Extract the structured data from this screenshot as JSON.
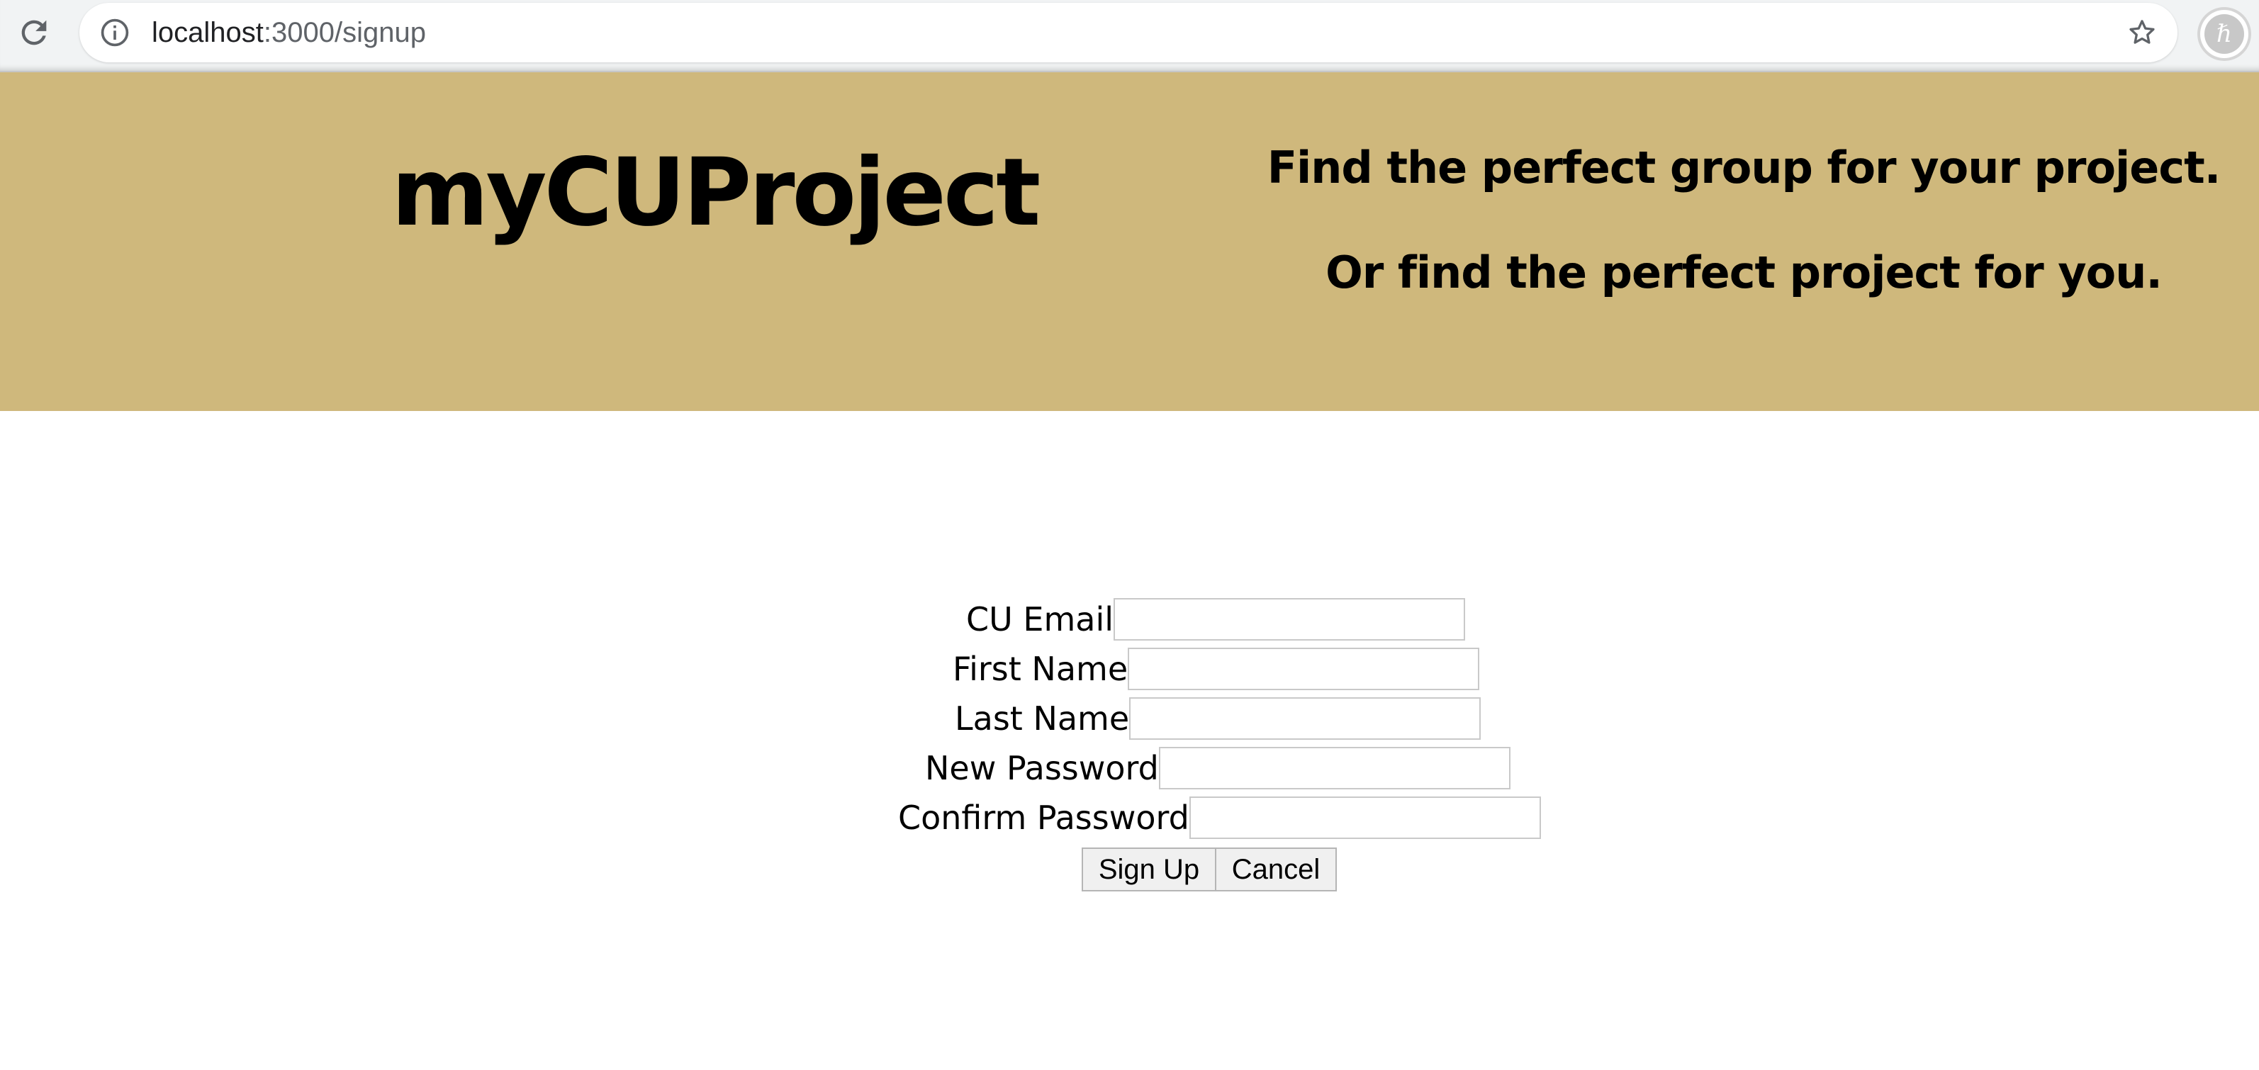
{
  "browser": {
    "url_host": "localhost",
    "url_path": ":3000/signup",
    "icons": {
      "reload": "reload-icon",
      "info": "info-icon",
      "star": "star-icon",
      "extension": "extension-icon"
    }
  },
  "header": {
    "title": "myCUProject",
    "tagline_1": "Find the perfect group for your project.",
    "tagline_2": "Or find the perfect project for you.",
    "background_color": "#cfb87c"
  },
  "form": {
    "fields": [
      {
        "label": "CU Email",
        "value": ""
      },
      {
        "label": "First Name",
        "value": ""
      },
      {
        "label": "Last Name",
        "value": ""
      },
      {
        "label": "New Password",
        "value": ""
      },
      {
        "label": "Confirm Password",
        "value": ""
      }
    ],
    "buttons": {
      "signup": "Sign Up",
      "cancel": "Cancel"
    }
  }
}
